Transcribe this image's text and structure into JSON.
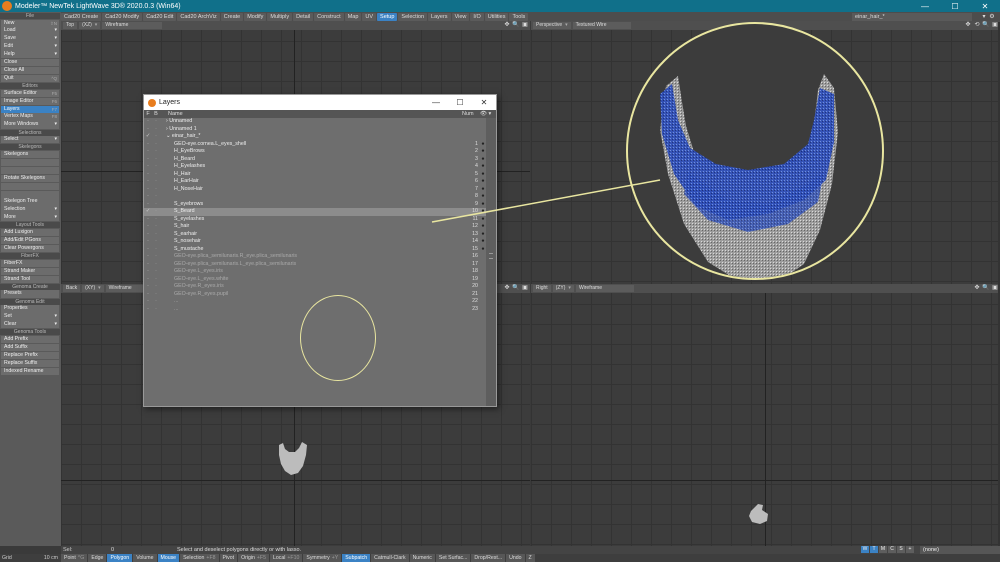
{
  "window": {
    "title": "Modeler™ NewTek LightWave 3D® 2020.0.3 (Win64)",
    "controls": [
      "—",
      "☐",
      "✕"
    ]
  },
  "tabs": [
    {
      "label": "Cad20 Create",
      "active": false
    },
    {
      "label": "Cad20 Modify",
      "active": false
    },
    {
      "label": "Cad20 Edit",
      "active": false
    },
    {
      "label": "Cad20 ArchViz",
      "active": false
    },
    {
      "label": "Create",
      "active": false
    },
    {
      "label": "Modify",
      "active": false
    },
    {
      "label": "Multiply",
      "active": false
    },
    {
      "label": "Detail",
      "active": false
    },
    {
      "label": "Construct",
      "active": false
    },
    {
      "label": "Map",
      "active": false
    },
    {
      "label": "UV",
      "active": false
    },
    {
      "label": "Setup",
      "active": true
    },
    {
      "label": "Selection",
      "active": false
    },
    {
      "label": "Layers",
      "active": false
    },
    {
      "label": "View",
      "active": false
    },
    {
      "label": "I/O",
      "active": false
    },
    {
      "label": "Utilities",
      "active": false
    },
    {
      "label": "Tools",
      "active": false
    }
  ],
  "current_object": "einar_hair_*",
  "sidebar": [
    {
      "type": "section",
      "label": "File"
    },
    {
      "type": "btn",
      "label": "New",
      "sc": "⇧N"
    },
    {
      "type": "btn",
      "label": "Load",
      "dd": true
    },
    {
      "type": "btn",
      "label": "Save",
      "dd": true
    },
    {
      "type": "btn",
      "label": "Edit",
      "dd": true
    },
    {
      "type": "btn",
      "label": "Help",
      "dd": true
    },
    {
      "type": "btn",
      "label": "Close"
    },
    {
      "type": "btn",
      "label": "Close All"
    },
    {
      "type": "btn",
      "label": "Quit",
      "sc": "^Q"
    },
    {
      "type": "section",
      "label": "Editors"
    },
    {
      "type": "btn",
      "label": "Surface Editor",
      "sc": "F5"
    },
    {
      "type": "btn",
      "label": "Image Editor",
      "sc": "F6"
    },
    {
      "type": "btn",
      "label": "Layers",
      "sc": "F7",
      "active": true
    },
    {
      "type": "btn",
      "label": "Vertex Maps",
      "sc": "F8"
    },
    {
      "type": "btn",
      "label": "More Windows",
      "dd": true
    },
    {
      "type": "section",
      "label": "Selections"
    },
    {
      "type": "btn",
      "label": "Select",
      "dd": true
    },
    {
      "type": "section",
      "label": "Skelegons"
    },
    {
      "type": "btn",
      "label": "Skelegons"
    },
    {
      "type": "btn",
      "label": "",
      "dim": true
    },
    {
      "type": "btn",
      "label": "",
      "dim": true
    },
    {
      "type": "btn",
      "label": "Rotate Skelegons"
    },
    {
      "type": "btn",
      "label": "",
      "dim": true
    },
    {
      "type": "btn",
      "label": "",
      "dim": true
    },
    {
      "type": "btn",
      "label": "Skelegon Tree"
    },
    {
      "type": "btn",
      "label": "Selection",
      "dd": true
    },
    {
      "type": "btn",
      "label": "More",
      "dd": true
    },
    {
      "type": "section",
      "label": "Layout Tools"
    },
    {
      "type": "btn",
      "label": "Add Luxigon"
    },
    {
      "type": "btn",
      "label": "Add/Edit PGons"
    },
    {
      "type": "btn",
      "label": "Clear Powergons"
    },
    {
      "type": "section",
      "label": "FiberFX"
    },
    {
      "type": "btn",
      "label": "FiberFX"
    },
    {
      "type": "btn",
      "label": "Strand Maker"
    },
    {
      "type": "btn",
      "label": "Strand Tool"
    },
    {
      "type": "section",
      "label": "Genoma Create"
    },
    {
      "type": "btn",
      "label": "Presets"
    },
    {
      "type": "section",
      "label": "Genoma Edit"
    },
    {
      "type": "btn",
      "label": "Properties"
    },
    {
      "type": "btn",
      "label": "Set",
      "dd": true
    },
    {
      "type": "btn",
      "label": "Clear",
      "dd": true
    },
    {
      "type": "section",
      "label": "Genoma Tools"
    },
    {
      "type": "btn",
      "label": "Add Prefix"
    },
    {
      "type": "btn",
      "label": "Add Suffix"
    },
    {
      "type": "btn",
      "label": "Replace Prefix"
    },
    {
      "type": "btn",
      "label": "Replace Suffix"
    },
    {
      "type": "btn",
      "label": "Indexed Rename"
    }
  ],
  "viewports": {
    "top_left": {
      "view": "Top",
      "axes": "(XZ)",
      "mode": "Wireframe"
    },
    "top_right": {
      "view": "Perspective",
      "mode": "Textured Wire"
    },
    "bottom_left": {
      "view": "Back",
      "axes": "(XY)",
      "mode": "Wireframe"
    },
    "bottom_right": {
      "view": "Right",
      "axes": "(ZY)",
      "mode": "Wireframe"
    }
  },
  "layers_panel": {
    "title": "Layers",
    "headers": {
      "f": "F",
      "b": "B",
      "name": "Name",
      "num": "Num"
    },
    "rows": [
      {
        "f": "",
        "b": "",
        "name": "Unnamed",
        "num": "",
        "dot": "",
        "indent": 1,
        "arrow": "›",
        "check": ""
      },
      {
        "f": "",
        "b": "",
        "name": "Unnamed 1",
        "num": "",
        "dot": "",
        "indent": 1,
        "arrow": "›",
        "check": ""
      },
      {
        "f": "",
        "b": "",
        "name": "einar_hair_*",
        "num": "",
        "dot": "",
        "indent": 1,
        "arrow": "⌄",
        "check": "✓"
      },
      {
        "f": "",
        "b": "",
        "name": "GEO-eye.cornea.L_eyes_shell",
        "num": "1",
        "dot": "●",
        "indent": 2
      },
      {
        "f": "",
        "b": "",
        "name": "H_EyeBrows",
        "num": "2",
        "dot": "●",
        "indent": 2
      },
      {
        "f": "",
        "b": "",
        "name": "H_Beard",
        "num": "3",
        "dot": "●",
        "indent": 2
      },
      {
        "f": "",
        "b": "",
        "name": "H_Eyelashes",
        "num": "4",
        "dot": "●",
        "indent": 2
      },
      {
        "f": "",
        "b": "",
        "name": "H_Hair",
        "num": "5",
        "dot": "●",
        "indent": 2
      },
      {
        "f": "",
        "b": "",
        "name": "H_EarHair",
        "num": "6",
        "dot": "●",
        "indent": 2
      },
      {
        "f": "",
        "b": "",
        "name": "H_NoseHair",
        "num": "7",
        "dot": "●",
        "indent": 2
      },
      {
        "f": "",
        "b": "",
        "name": "",
        "num": "8",
        "dot": "●",
        "indent": 2
      },
      {
        "f": "",
        "b": "",
        "name": "S_eyebrows",
        "num": "9",
        "dot": "●",
        "indent": 2
      },
      {
        "f": "✓",
        "b": "",
        "name": "S_Beard",
        "num": "10",
        "dot": "●",
        "indent": 2,
        "sel": true
      },
      {
        "f": "",
        "b": "",
        "name": "S_eyelashes",
        "num": "11",
        "dot": "●",
        "indent": 2
      },
      {
        "f": "",
        "b": "",
        "name": "S_hair",
        "num": "12",
        "dot": "●",
        "indent": 2
      },
      {
        "f": "",
        "b": "",
        "name": "S_earhair",
        "num": "13",
        "dot": "●",
        "indent": 2
      },
      {
        "f": "",
        "b": "",
        "name": "S_nosehair",
        "num": "14",
        "dot": "●",
        "indent": 2
      },
      {
        "f": "",
        "b": "",
        "name": "S_mustache",
        "num": "15",
        "dot": "●",
        "indent": 2
      },
      {
        "f": "",
        "b": "",
        "name": "GEO-eye.plica_semilunaris.R_eye.plica_semilunaris",
        "num": "16",
        "dot": "",
        "indent": 2,
        "dim": true
      },
      {
        "f": "",
        "b": "",
        "name": "GEO-eye.plica_semilunaris.L_eye.plica_semilunaris",
        "num": "17",
        "dot": "",
        "indent": 2,
        "dim": true
      },
      {
        "f": "",
        "b": "",
        "name": "GEO-eye.L_eyes.iris",
        "num": "18",
        "dot": "",
        "indent": 2,
        "dim": true
      },
      {
        "f": "",
        "b": "",
        "name": "GEO-eye.L_eyes.white",
        "num": "19",
        "dot": "",
        "indent": 2,
        "dim": true
      },
      {
        "f": "",
        "b": "",
        "name": "GEO-eye.R_eyes.iris",
        "num": "20",
        "dot": "",
        "indent": 2,
        "dim": true
      },
      {
        "f": "",
        "b": "",
        "name": "GEO-eye.R_eyes.pupil",
        "num": "21",
        "dot": "",
        "indent": 2,
        "dim": true
      },
      {
        "f": "",
        "b": "",
        "name": "...",
        "num": "22",
        "dot": "",
        "indent": 2,
        "dim": true
      },
      {
        "f": "",
        "b": "",
        "name": "...",
        "num": "23",
        "dot": "",
        "indent": 2,
        "dim": true
      }
    ]
  },
  "status": {
    "sel_label": "Sel:",
    "sel_value": "0",
    "hint": "Select and deselect polygons directly or with lasso.",
    "view_modes": [
      {
        "label": "W",
        "on": true
      },
      {
        "label": "T",
        "on": true
      },
      {
        "label": "M",
        "on": false
      },
      {
        "label": "C",
        "on": false
      },
      {
        "label": "S",
        "on": false
      },
      {
        "label": "+",
        "on": false
      }
    ],
    "layer_dropdown": "(none)"
  },
  "bottombar": {
    "grid_label": "Grid",
    "grid_value": "10 cm",
    "buttons": [
      {
        "label": "Point",
        "k": "^G",
        "on": false
      },
      {
        "label": "Edge",
        "k": "",
        "on": false
      },
      {
        "label": "Polygon",
        "k": "",
        "on": true
      },
      {
        "label": "Volume",
        "k": "",
        "on": false
      },
      {
        "label": "Mouse",
        "k": "",
        "on": true
      },
      {
        "label": "Selection",
        "k": "+F8",
        "on": false
      },
      {
        "label": "Pivot",
        "k": "",
        "on": false
      },
      {
        "label": "Origin",
        "k": "+F5",
        "on": false
      },
      {
        "label": "Local",
        "k": "+F10",
        "on": false
      },
      {
        "label": "Symmetry",
        "k": "+Y",
        "on": false
      },
      {
        "label": "Subpatch",
        "k": "",
        "on": true
      },
      {
        "label": "Catmull-Clark",
        "k": "",
        "on": false
      },
      {
        "label": "Numeric",
        "k": "",
        "on": false
      },
      {
        "label": "Set Surfac...",
        "k": "",
        "on": false
      },
      {
        "label": "Drop/Rest...",
        "k": "",
        "on": false
      },
      {
        "label": "Undo",
        "k": "",
        "on": false
      },
      {
        "label": "Z",
        "k": "",
        "on": false
      }
    ]
  },
  "colors": {
    "titlebar": "#10708a",
    "accent": "#3b82c4",
    "callout": "#e9e6a0",
    "hair_blue": "#2f4fb8",
    "hair_grey": "#b8b8b8"
  }
}
